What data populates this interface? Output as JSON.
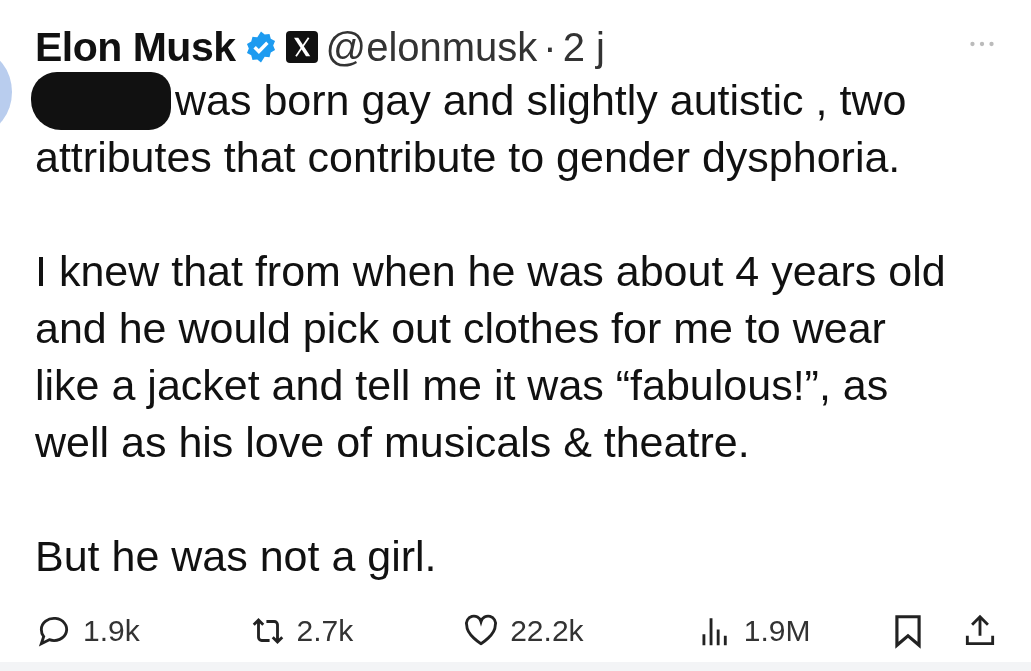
{
  "author": {
    "name": "Elon Musk",
    "verified": true,
    "handle": "@elonmusk",
    "separator": "·",
    "time": "2 j"
  },
  "paragraphs": [
    [
      "was born gay and slightly autistic , two",
      "attributes that contribute to gender dysphoria."
    ],
    [
      "I knew that from when he was about 4 years old",
      "and he would pick out clothes for me to wear",
      "like a jacket and tell me it was “fabulous!”, as",
      "well as his love of musicals & theatre."
    ],
    [
      "But he was not a girl."
    ]
  ],
  "actions": [
    {
      "kind": "reply",
      "count": "1.9k"
    },
    {
      "kind": "repost",
      "count": "2.7k"
    },
    {
      "kind": "like",
      "count": "22.2k"
    },
    {
      "kind": "views",
      "count": "1.9M"
    },
    {
      "kind": "bookmark"
    },
    {
      "kind": "share"
    }
  ]
}
